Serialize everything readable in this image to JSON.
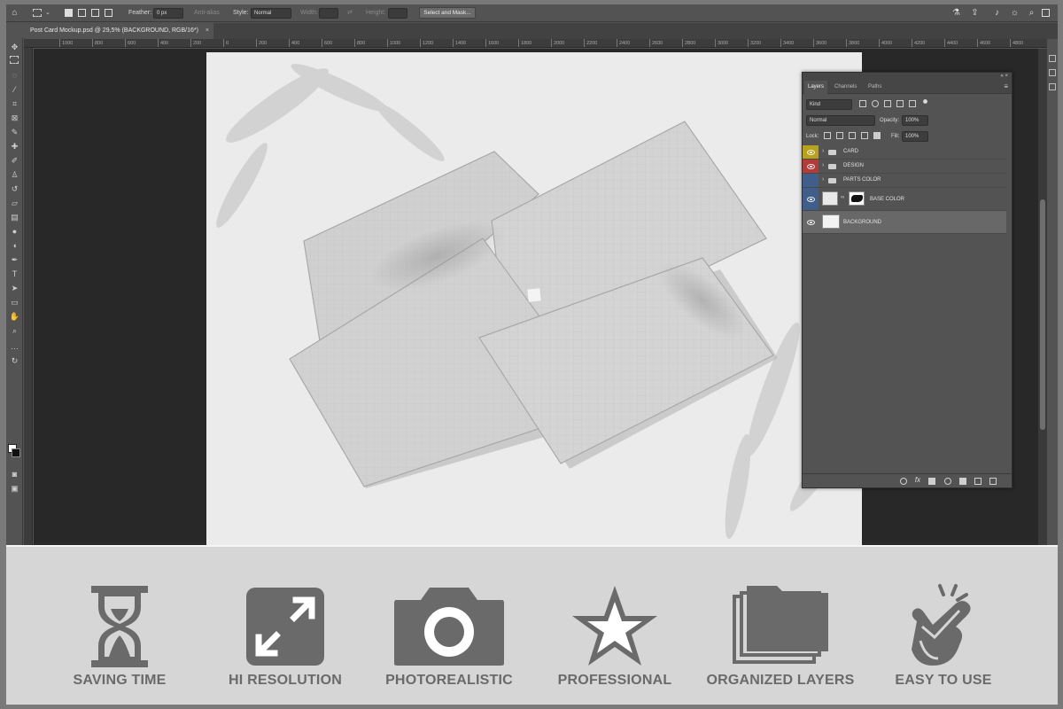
{
  "options_bar": {
    "feather_label": "Feather:",
    "feather_value": "0 px",
    "anti_alias_label": "Anti-alias",
    "style_label": "Style:",
    "style_value": "Normal",
    "width_label": "Width:",
    "height_label": "Height:",
    "select_mask_label": "Select and Mask..."
  },
  "document_tab": {
    "title": "Post Card Mockup.psd @ 29,5% (BACKGROUND, RGB/16*)",
    "close": "×"
  },
  "ruler": {
    "ticks": [
      "1000",
      "800",
      "600",
      "400",
      "200",
      "0",
      "200",
      "400",
      "600",
      "800",
      "1000",
      "1200",
      "1400",
      "1600",
      "1800",
      "2000",
      "2200",
      "2400",
      "2600",
      "2800",
      "3000",
      "3200",
      "3400",
      "3600",
      "3800",
      "4000",
      "4200",
      "4400",
      "4600",
      "4800"
    ]
  },
  "layers_panel": {
    "tabs": [
      "Layers",
      "Channels",
      "Paths"
    ],
    "kind_label": "Kind",
    "blend_mode": "Normal",
    "opacity_label": "Opacity:",
    "opacity_value": "100%",
    "lock_label": "Lock:",
    "fill_label": "Fill:",
    "fill_value": "100%",
    "layers": [
      {
        "name": "CARD",
        "type": "group",
        "color": "#b8a21a",
        "visible": true
      },
      {
        "name": "DESIGN",
        "type": "group",
        "color": "#b53a3a",
        "visible": true
      },
      {
        "name": "PARTS COLOR",
        "type": "group",
        "color": "#3f5f8a",
        "visible": false
      },
      {
        "name": "BASE COLOR",
        "type": "layer-mask",
        "color": "#3f5f8a",
        "visible": true
      },
      {
        "name": "BACKGROUND",
        "type": "layer",
        "color": "",
        "visible": true,
        "selected": true
      }
    ]
  },
  "features": [
    {
      "label": "SAVING TIME",
      "icon": "hourglass-icon"
    },
    {
      "label": "HI RESOLUTION",
      "icon": "expand-arrows-icon"
    },
    {
      "label": "PHOTOREALISTIC",
      "icon": "camera-icon"
    },
    {
      "label": "PROFESSIONAL",
      "icon": "star-icon"
    },
    {
      "label": "ORGANIZED LAYERS",
      "icon": "stacked-layers-icon"
    },
    {
      "label": "EASY TO USE",
      "icon": "pointing-hand-icon"
    }
  ],
  "colors": {
    "feature_icon": "#6a6a6a",
    "feature_bg": "#d6d6d6",
    "ps_ui": "#535353"
  }
}
